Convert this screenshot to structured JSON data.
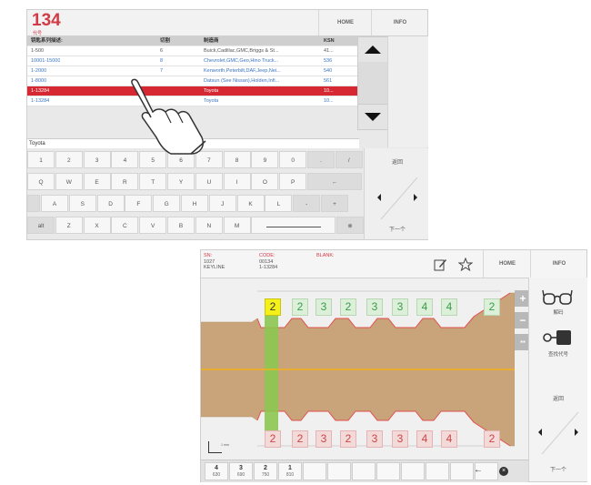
{
  "screen1": {
    "code": "134",
    "code_sublabel": "代号",
    "home_label": "HOME",
    "info_label": "INFO",
    "columns": [
      "钥匙系列描述:",
      "切割",
      "制造商",
      "KSN"
    ],
    "rows": [
      {
        "desc": "1-500",
        "cut": "6",
        "maker": "Buick,Cadillac,GMC,Briggs & St...",
        "ksn": "41..."
      },
      {
        "desc": "10001-15000",
        "cut": "8",
        "maker": "Chevrolet,GMC,Geo,Hino Truck...",
        "ksn": "536"
      },
      {
        "desc": "1-2000",
        "cut": "7",
        "maker": "Kenworth,Peterbilt,DAF,Jeep,Nei...",
        "ksn": "540"
      },
      {
        "desc": "1-8000",
        "cut": "",
        "maker": "Datsun (See Nissan),Holden,Infi...",
        "ksn": "561"
      },
      {
        "desc": "1-13284",
        "cut": "",
        "maker": "Toyota",
        "ksn": "10..."
      },
      {
        "desc": "1-13284",
        "cut": "",
        "maker": "Toyota",
        "ksn": "10..."
      }
    ],
    "input_value": "Toyota",
    "keyboard": {
      "row1": [
        "1",
        "2",
        "3",
        "4",
        "5",
        "6",
        "7",
        "8",
        "9",
        "0",
        ".",
        "/"
      ],
      "row2": [
        "Q",
        "W",
        "E",
        "R",
        "T",
        "Y",
        "U",
        "I",
        "O",
        "P",
        "←"
      ],
      "row3": [
        "A",
        "S",
        "D",
        "F",
        "G",
        "H",
        "J",
        "K",
        "L",
        "-",
        "+"
      ],
      "row4": [
        "alt",
        "Z",
        "X",
        "C",
        "V",
        "B",
        "N",
        "M",
        "⊗"
      ]
    },
    "back_label": "返回",
    "next_label": "下一个"
  },
  "screen2": {
    "sn_label": "SN:",
    "sn_values": [
      "1027",
      "KEYLINE"
    ],
    "code_label": "CODE:",
    "code_values": [
      "00134",
      "1-13284"
    ],
    "blank_label": "BLANK:",
    "home_label": "HOME",
    "info_label": "INFO",
    "top_cuts": [
      "2",
      "2",
      "3",
      "2",
      "3",
      "3",
      "4",
      "4",
      "2"
    ],
    "bottom_cuts": [
      "2",
      "2",
      "3",
      "2",
      "3",
      "3",
      "4",
      "4",
      "2"
    ],
    "decode_label": "解码",
    "find_code_label": "查找代号",
    "back_label": "返回",
    "next_label": "下一个",
    "plus_label": "+",
    "minus_label": "−",
    "grid_label": "▪▪",
    "scale_label": "1 mm",
    "bottom_values": [
      {
        "depth": "4",
        "value": "630"
      },
      {
        "depth": "3",
        "value": "690"
      },
      {
        "depth": "2",
        "value": "750"
      },
      {
        "depth": "1",
        "value": "810"
      }
    ],
    "colors": {
      "key_fill": "#c9a47a",
      "center_line": "#f2b21a",
      "highlight": "#8cc751"
    }
  }
}
